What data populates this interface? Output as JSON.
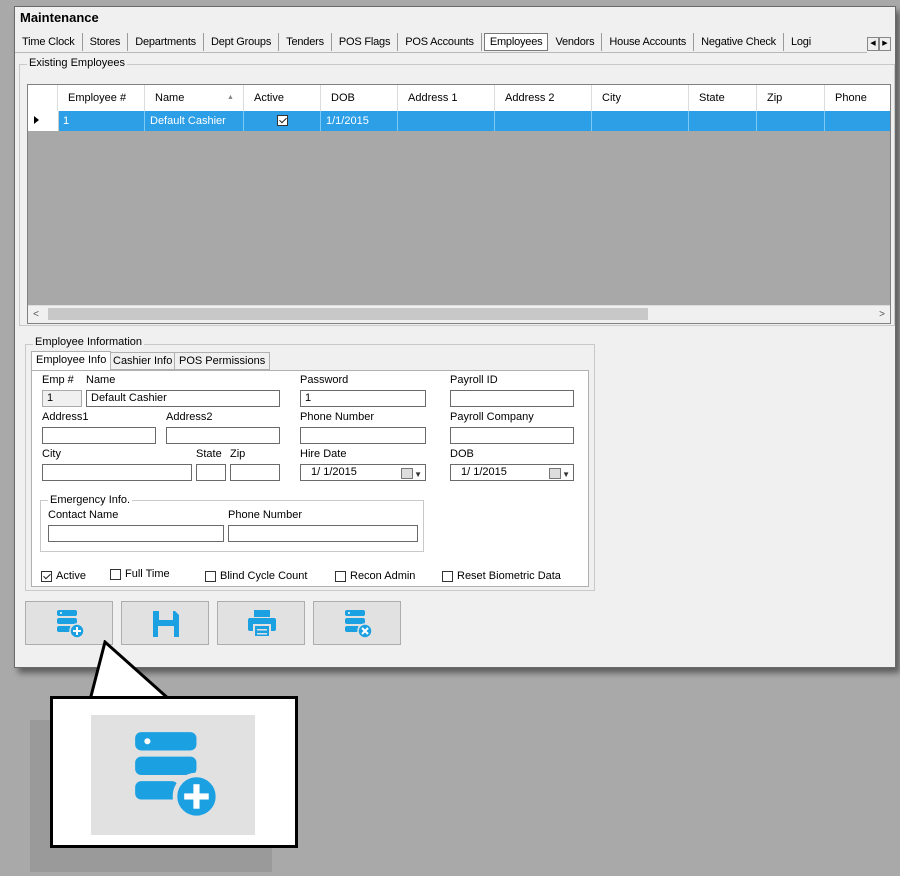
{
  "window": {
    "title": "Maintenance"
  },
  "tabs": [
    "Time Clock",
    "Stores",
    "Departments",
    "Dept Groups",
    "Tenders",
    "POS Flags",
    "POS Accounts",
    "Employees",
    "Vendors",
    "House Accounts",
    "Negative Check",
    "Logi"
  ],
  "selected_tab": "Employees",
  "existing": {
    "group_label": "Existing Employees",
    "columns": [
      "Employee #",
      "Name",
      "Active",
      "DOB",
      "Address 1",
      "Address 2",
      "City",
      "State",
      "Zip",
      "Phone"
    ],
    "sort_indicator": "▲",
    "rows": [
      {
        "employee_no": "1",
        "name": "Default Cashier",
        "active": true,
        "dob": "1/1/2015",
        "address1": "",
        "address2": "",
        "city": "",
        "state": "",
        "zip": "",
        "phone": ""
      }
    ],
    "scroll_left": "<",
    "scroll_right": ">"
  },
  "info": {
    "group_label": "Employee Information",
    "tabs": [
      "Employee Info",
      "Cashier Info",
      "POS Permissions"
    ],
    "selected_tab": "Employee Info",
    "labels": {
      "emp_no": "Emp #",
      "name": "Name",
      "password": "Password",
      "payroll_id": "Payroll ID",
      "address1": "Address1",
      "address2": "Address2",
      "phone_number": "Phone Number",
      "payroll_company": "Payroll Company",
      "city": "City",
      "state": "State",
      "zip": "Zip",
      "hire_date": "Hire Date",
      "dob": "DOB",
      "emergency": "Emergency Info.",
      "contact_name": "Contact Name",
      "emergency_phone": "Phone Number"
    },
    "values": {
      "emp_no": "1",
      "name": "Default Cashier",
      "password": "1",
      "payroll_id": "",
      "address1": "",
      "address2": "",
      "phone_number": "",
      "payroll_company": "",
      "city": "",
      "state": "",
      "zip": "",
      "hire_date": "1/ 1/2015",
      "dob": "1/ 1/2015",
      "contact_name": "",
      "emergency_phone": ""
    },
    "checkboxes": [
      {
        "label": "Active",
        "checked": true
      },
      {
        "label": "Full Time",
        "checked": false
      },
      {
        "label": "Blind Cycle Count",
        "checked": false
      },
      {
        "label": "Recon Admin",
        "checked": false
      },
      {
        "label": "Reset Biometric Data",
        "checked": false
      }
    ]
  },
  "toolbar": {
    "buttons": [
      {
        "icon": "add-record-icon"
      },
      {
        "icon": "save-icon"
      },
      {
        "icon": "print-icon"
      },
      {
        "icon": "delete-record-icon"
      }
    ]
  },
  "callout": {
    "icon": "add-record-icon"
  },
  "colors": {
    "accent": "#2c9fe6",
    "icon_blue": "#1ba1e2",
    "selection": "#2c9fe6"
  }
}
